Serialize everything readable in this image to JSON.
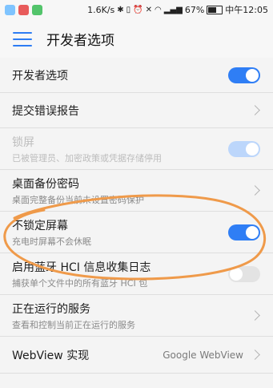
{
  "status_bar": {
    "speed": "1.6K/s",
    "battery": "67%",
    "battery_level": 0.67,
    "carrier_time": "中午12:05",
    "icons": [
      "bluetooth-icon",
      "vibrate-icon",
      "alarm-icon",
      "mute-icon",
      "wifi-icon",
      "signal-icon",
      "battery-icon"
    ]
  },
  "app_bar": {
    "title": "开发者选项"
  },
  "items": [
    {
      "title": "开发者选项",
      "subtitle": "",
      "control": "toggle",
      "state": "on"
    },
    {
      "title": "提交错误报告",
      "subtitle": "",
      "control": "chevron"
    },
    {
      "title": "锁屏",
      "subtitle": "已被管理员、加密政策或凭据存储停用",
      "control": "toggle",
      "state": "disabled-on"
    },
    {
      "title": "桌面备份密码",
      "subtitle": "桌面完整备份当前未设置密码保护",
      "control": "chevron"
    },
    {
      "title": "不锁定屏幕",
      "subtitle": "充电时屏幕不会休眠",
      "control": "toggle",
      "state": "on"
    },
    {
      "title": "启用蓝牙 HCI 信息收集日志",
      "subtitle": "捕获单个文件中的所有蓝牙 HCI 包",
      "control": "toggle",
      "state": "off"
    },
    {
      "title": "正在运行的服务",
      "subtitle": "查看和控制当前正在运行的服务",
      "control": "chevron"
    },
    {
      "title": "WebView 实现",
      "subtitle": "",
      "value": "Google WebView",
      "control": "chevron"
    }
  ],
  "colors": {
    "accent": "#2f7ef5",
    "annotation": "#ef9a4a"
  }
}
